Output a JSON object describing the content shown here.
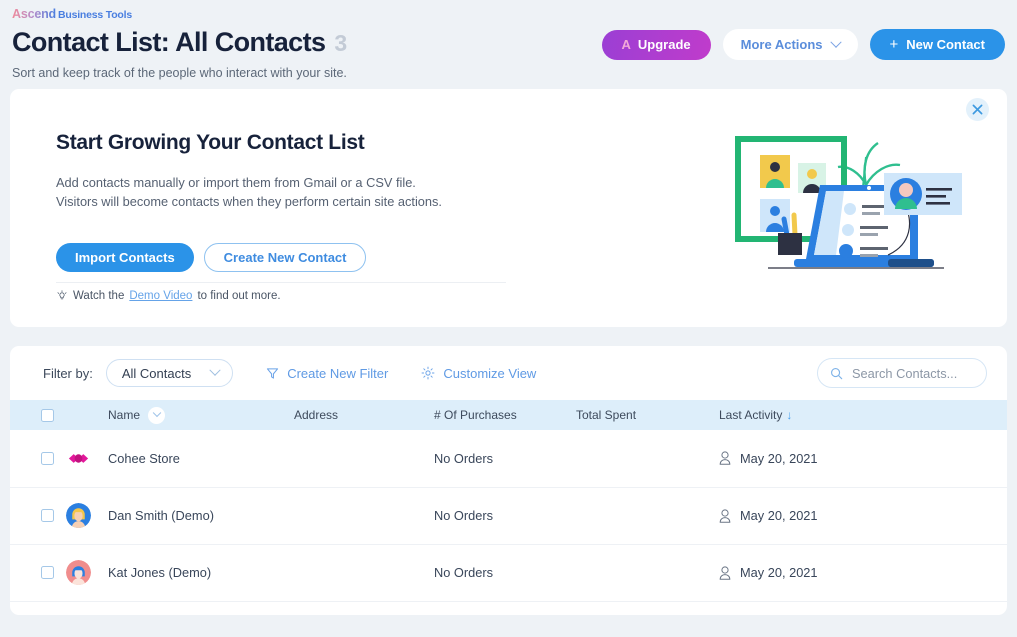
{
  "brand": {
    "name": "Ascend",
    "suffix": "Business Tools"
  },
  "header": {
    "title": "Contact List: All Contacts",
    "count": "3",
    "subtitle": "Sort and keep track of the people who interact with your site.",
    "upgrade_label": "Upgrade",
    "upgrade_icon": "a-logo-icon",
    "more_actions_label": "More Actions",
    "more_actions_icon": "chevron-down-icon",
    "new_contact_label": "New Contact",
    "new_contact_icon": "plus-icon"
  },
  "banner": {
    "title": "Start Growing Your Contact List",
    "line1": "Add contacts manually or import them from Gmail or a CSV file.",
    "line2": "Visitors will become contacts when they perform certain site actions.",
    "import_label": "Import Contacts",
    "create_label": "Create New Contact",
    "demo_prefix": "Watch the",
    "demo_link": "Demo Video",
    "demo_suffix": "to find out more.",
    "demo_icon": "lightbulb-icon",
    "close_icon": "close-icon"
  },
  "filters": {
    "filter_by_label": "Filter by:",
    "selected_filter": "All Contacts",
    "filter_chevron_icon": "chevron-down-icon",
    "create_filter_label": "Create New Filter",
    "create_filter_icon": "funnel-icon",
    "customize_view_label": "Customize View",
    "customize_view_icon": "gear-icon",
    "search_placeholder": "Search Contacts...",
    "search_value": "",
    "search_icon": "search-icon"
  },
  "table": {
    "columns": [
      {
        "key": "checkbox",
        "label": ""
      },
      {
        "key": "avatar",
        "label": ""
      },
      {
        "key": "name",
        "label": "Name"
      },
      {
        "key": "address",
        "label": "Address"
      },
      {
        "key": "purchases",
        "label": "# Of Purchases"
      },
      {
        "key": "spent",
        "label": "Total Spent"
      },
      {
        "key": "activity",
        "label": "Last Activity"
      }
    ],
    "name_sort_icon": "chevron-down-icon",
    "activity_sort_icon": "arrow-down-icon",
    "rows": [
      {
        "name": "Cohee Store",
        "address": "",
        "purchases": "No Orders",
        "spent": "",
        "activity": "May 20, 2021",
        "avatar_type": "logo-pink",
        "activity_icon": "person-icon"
      },
      {
        "name": "Dan Smith (Demo)",
        "address": "",
        "purchases": "No Orders",
        "spent": "",
        "activity": "May 20, 2021",
        "avatar_type": "person-blue",
        "activity_icon": "person-icon"
      },
      {
        "name": "Kat Jones (Demo)",
        "address": "",
        "purchases": "No Orders",
        "spent": "",
        "activity": "May 20, 2021",
        "avatar_type": "person-pink",
        "activity_icon": "person-icon"
      }
    ]
  },
  "colors": {
    "page_bg": "#eef2f6",
    "accent_blue": "#2b93e8",
    "link_blue": "#5f9ae4",
    "upgrade_purple": "#b03ad0",
    "header_row_bg": "#ddeefa",
    "title_dark": "#17223b"
  }
}
